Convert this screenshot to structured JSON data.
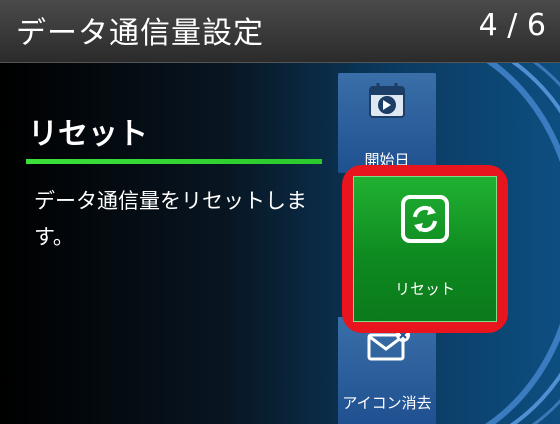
{
  "header": {
    "title": "データ通信量設定",
    "page_indicator": "4 / 6"
  },
  "section": {
    "title": "リセット",
    "description": "データ通信量をリセットします。"
  },
  "menu": {
    "items": [
      {
        "label": "開始日",
        "icon": "calendar-arrow-icon",
        "selected": false
      },
      {
        "label": "リセット",
        "icon": "reset-icon",
        "selected": true
      },
      {
        "label": "アイコン消去",
        "icon": "envelope-delete-icon",
        "selected": false
      }
    ]
  },
  "colors": {
    "accent_green": "#2cc92c",
    "highlight_red": "#e8141e",
    "menu_blue": "#2a5f9b"
  }
}
